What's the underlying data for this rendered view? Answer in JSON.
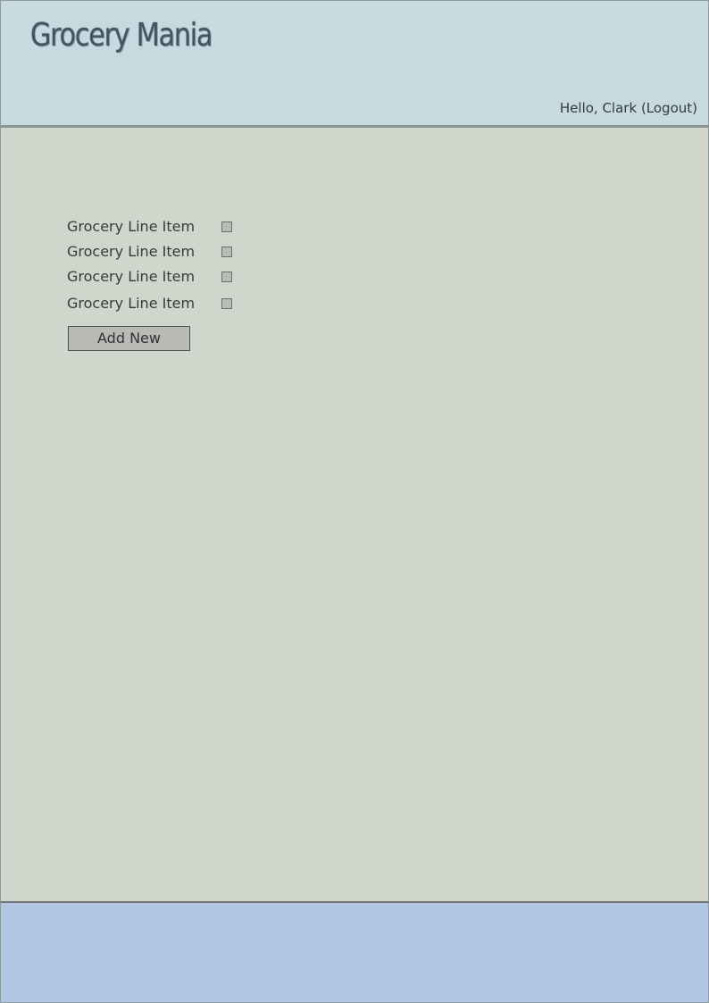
{
  "header": {
    "app_title": "Grocery Mania",
    "greeting": "Hello, Clark",
    "logout_label": "(Logout)"
  },
  "main": {
    "items": [
      {
        "label": "Grocery Line Item",
        "checked": false
      },
      {
        "label": "Grocery Line Item",
        "checked": false
      },
      {
        "label": "Grocery Line Item",
        "checked": false
      },
      {
        "label": "Grocery Line Item",
        "checked": false
      }
    ],
    "add_button_label": "Add New"
  },
  "colors": {
    "header_bg": "#c7dae0",
    "main_bg": "#d0d6cb",
    "footer_bg": "#b0c6e2",
    "title_color": "#3f5760",
    "text_color": "#353b3d",
    "button_bg": "#b9bab6"
  }
}
